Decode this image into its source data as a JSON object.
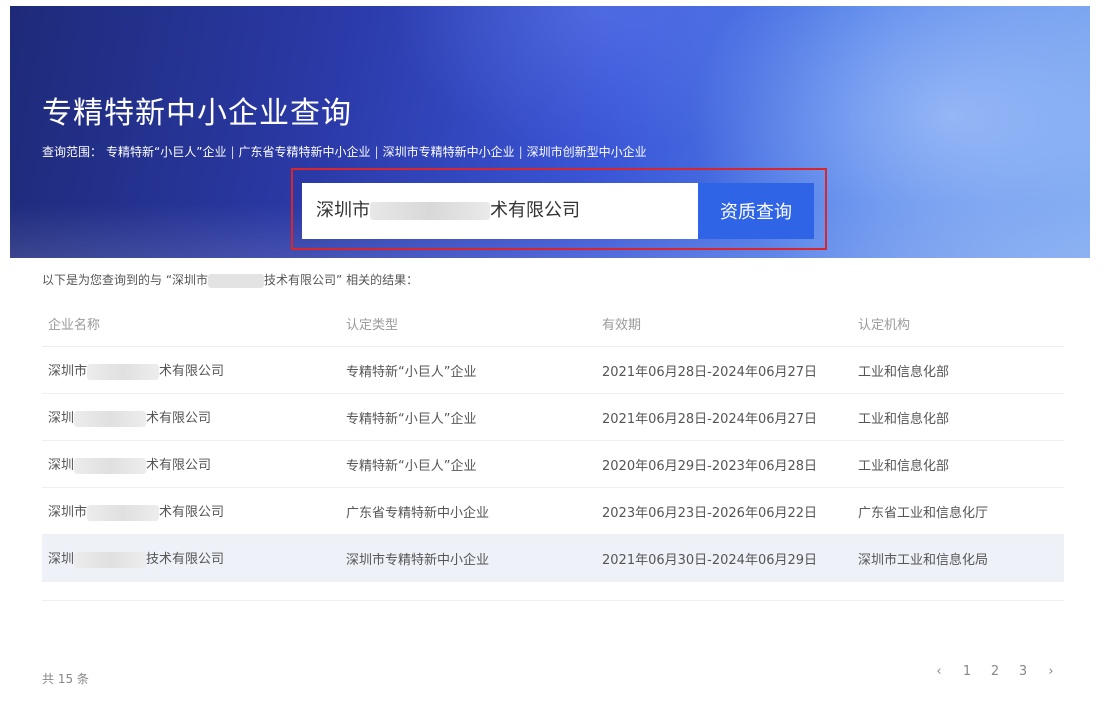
{
  "banner": {
    "title": "专精特新中小企业查询",
    "scope_label": "查询范围：",
    "scope_items": [
      "专精特新“小巨人”企业",
      "广东省专精特新中小企业",
      "深圳市专精特新中小企业",
      "深圳市创新型中小企业"
    ]
  },
  "search": {
    "value_prefix": "深圳市",
    "value_suffix": "术有限公司",
    "button_label": "资质查询"
  },
  "result_summary": {
    "prefix": "以下是为您查询到的与 “深圳市",
    "suffix": "技术有限公司” 相关的结果："
  },
  "table": {
    "headers": [
      "企业名称",
      "认定类型",
      "有效期",
      "认定机构"
    ],
    "rows": [
      {
        "name_prefix": "深圳市",
        "name_suffix": "术有限公司",
        "type": "专精特新“小巨人”企业",
        "period": "2021年06月28日-2024年06月27日",
        "agency": "工业和信息化部"
      },
      {
        "name_prefix": "深圳",
        "name_suffix": "术有限公司",
        "type": "专精特新“小巨人”企业",
        "period": "2021年06月28日-2024年06月27日",
        "agency": "工业和信息化部"
      },
      {
        "name_prefix": "深圳",
        "name_suffix": "术有限公司",
        "type": "专精特新“小巨人”企业",
        "period": "2020年06月29日-2023年06月28日",
        "agency": "工业和信息化部"
      },
      {
        "name_prefix": "深圳市",
        "name_suffix": "术有限公司",
        "type": "广东省专精特新中小企业",
        "period": "2023年06月23日-2026年06月22日",
        "agency": "广东省工业和信息化厅"
      },
      {
        "name_prefix": "深圳",
        "name_suffix": "技术有限公司",
        "type": "深圳市专精特新中小企业",
        "period": "2021年06月30日-2024年06月29日",
        "agency": "深圳市工业和信息化局"
      }
    ]
  },
  "pagination": {
    "total": "共 15 条",
    "prev": "‹",
    "pages": [
      "1",
      "2",
      "3"
    ],
    "next": "›"
  },
  "colors": {
    "accent": "#2f64e6",
    "highlight_border": "#d8262c"
  }
}
